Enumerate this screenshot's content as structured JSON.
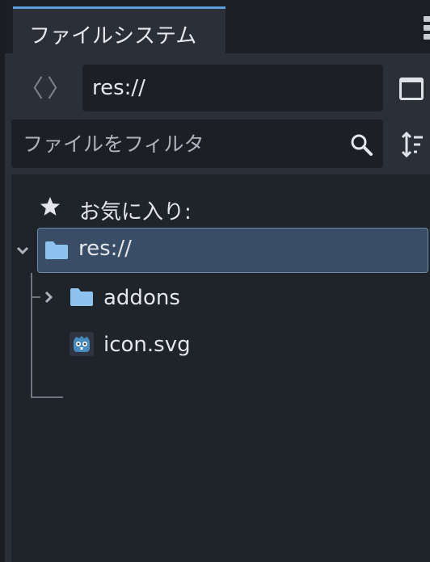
{
  "tab": {
    "label": "ファイルシステム"
  },
  "nav": {
    "back": "〈",
    "forward": "〉"
  },
  "path": {
    "value": "res://"
  },
  "filter": {
    "placeholder": "ファイルをフィルタ",
    "value": ""
  },
  "tree": {
    "favorites_label": "お気に入り:",
    "root": {
      "label": "res://",
      "expanded": true,
      "selected": true
    },
    "children": [
      {
        "label": "addons",
        "type": "folder",
        "expanded": false
      },
      {
        "label": "icon.svg",
        "type": "file",
        "icon": "godot-icon"
      }
    ]
  },
  "colors": {
    "accent": "#5b9ee0",
    "folder": "#8ec3f0",
    "selection_bg": "#394e66",
    "panel_bg": "#2a2f38",
    "tree_bg": "#1f232a"
  },
  "icons": {
    "star": "star-icon",
    "folder": "folder-icon",
    "search": "search-icon",
    "sort": "sort-icon",
    "layout": "layout-toggle-icon",
    "menu": "kebab-menu-icon"
  }
}
